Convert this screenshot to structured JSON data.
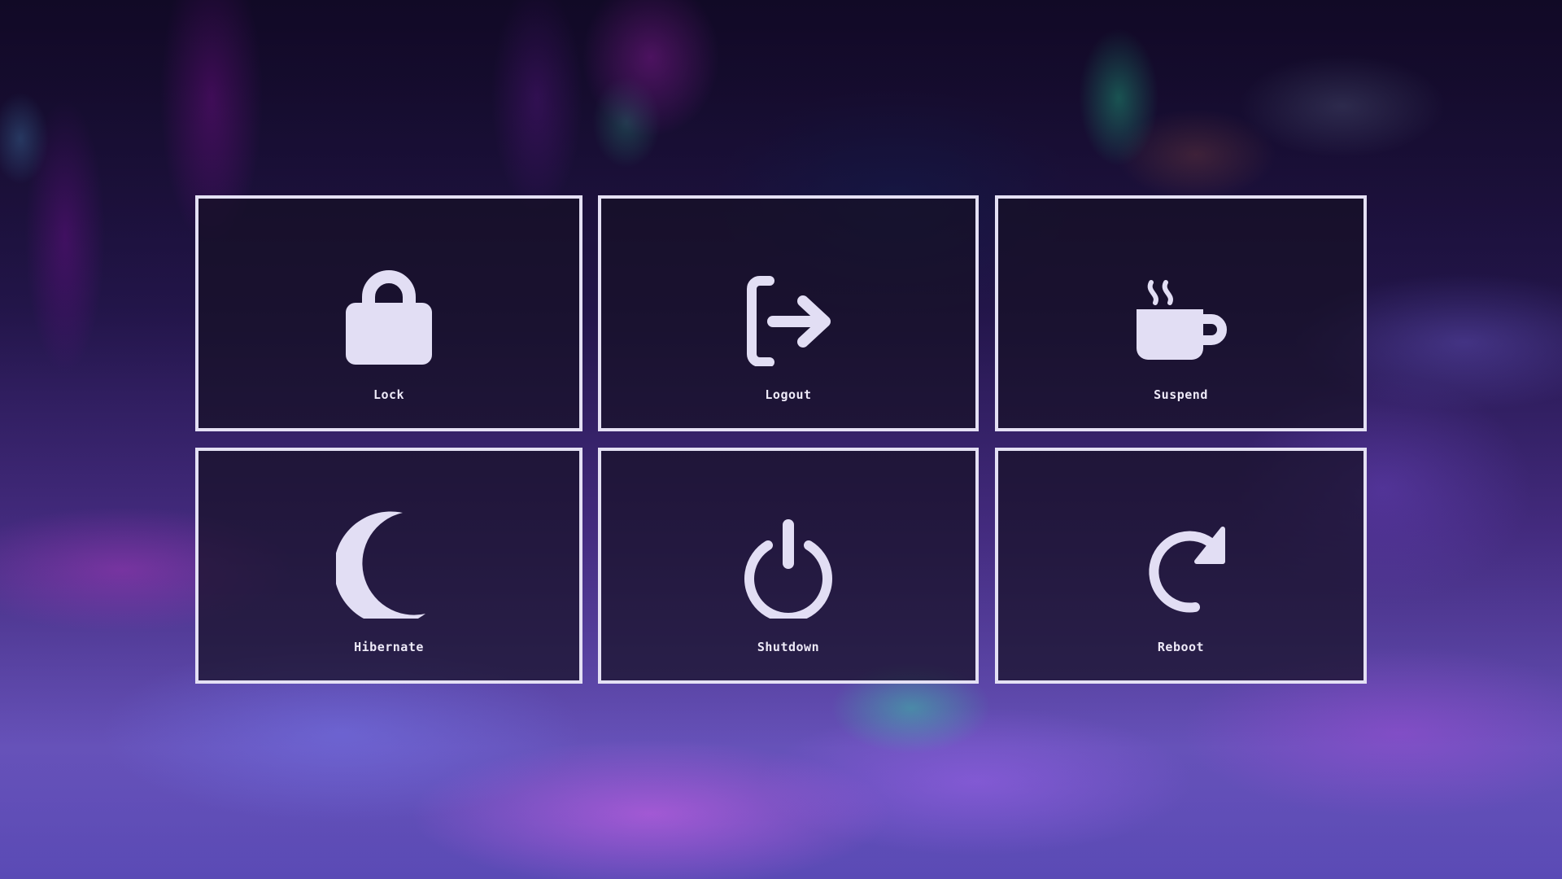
{
  "power_menu": {
    "items": [
      {
        "label": "Lock",
        "icon": "lock-icon"
      },
      {
        "label": "Logout",
        "icon": "logout-icon"
      },
      {
        "label": "Suspend",
        "icon": "coffee-cup-icon"
      },
      {
        "label": "Hibernate",
        "icon": "moon-icon"
      },
      {
        "label": "Shutdown",
        "icon": "power-icon"
      },
      {
        "label": "Reboot",
        "icon": "reboot-icon"
      }
    ]
  },
  "colors": {
    "tile_border": "#e4e0f4",
    "icon_fill": "#e2def4",
    "label_text": "#eeeaf8",
    "tile_background": "#161026"
  }
}
